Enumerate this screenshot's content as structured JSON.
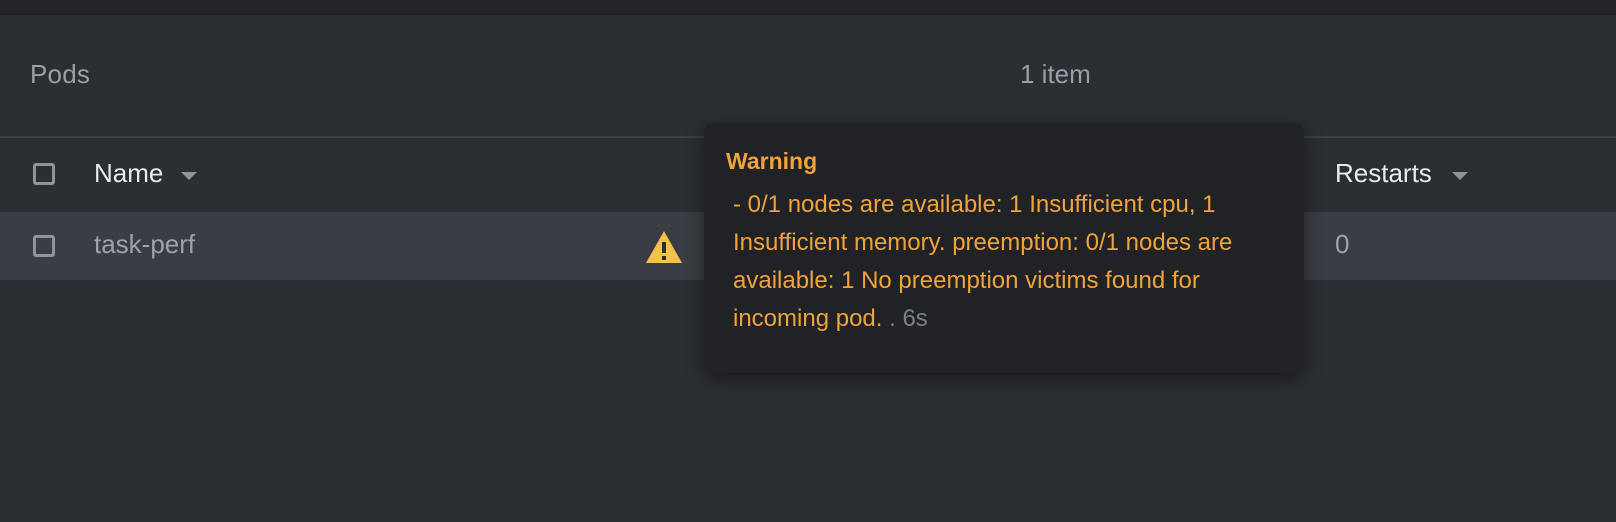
{
  "header": {
    "title": "Pods",
    "count": "1 item"
  },
  "table": {
    "columns": {
      "name": "Name",
      "restarts": "Restarts"
    },
    "rows": [
      {
        "name": "task-perf",
        "restarts": "0",
        "status_icon": "warning-triangle-icon"
      }
    ]
  },
  "tooltip": {
    "title": "Warning",
    "message": "- 0/1 nodes are available: 1 Insufficient cpu, 1 Insufficient memory. preemption: 0/1 nodes are available: 1 No preemption victims found for incoming pod.",
    "age": ". 6s"
  },
  "colors": {
    "background": "#2b2e33",
    "row_highlight": "#3a3d43",
    "warning": "#f0a33a",
    "warning_icon": "#f4c24a",
    "tooltip_bg": "#202226"
  }
}
